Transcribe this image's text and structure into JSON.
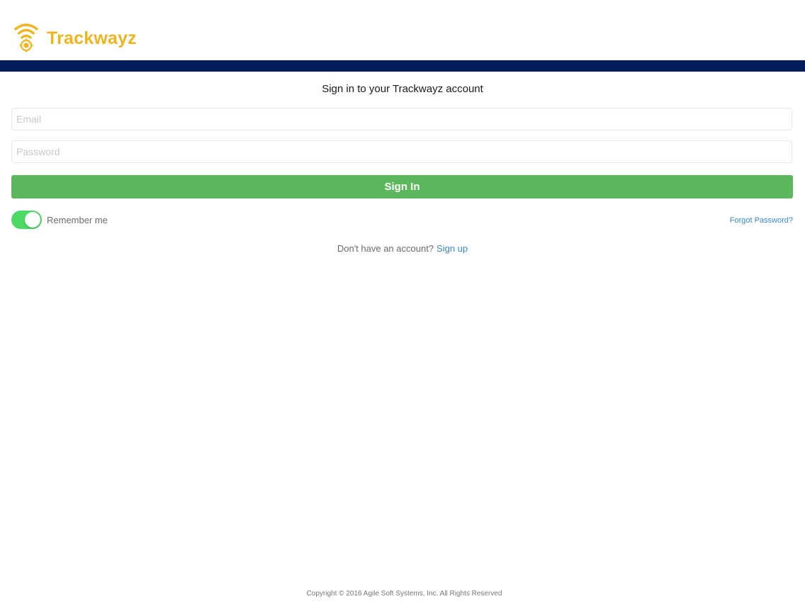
{
  "colors": {
    "brand": "#f0b41c",
    "nav_bar": "#041c5c",
    "primary_button": "#5cb85c",
    "toggle_on": "#4cd964",
    "link": "#3a88c8"
  },
  "header": {
    "logo_icon": "wifi-location-icon",
    "brand_name": "Trackwayz"
  },
  "form": {
    "title": "Sign in to your Trackwayz account",
    "email": {
      "value": "",
      "placeholder": "Email"
    },
    "password": {
      "value": "",
      "placeholder": "Password"
    },
    "submit_label": "Sign In",
    "remember": {
      "label": "Remember me",
      "checked": true
    },
    "forgot_label": "Forgot Password?"
  },
  "signup": {
    "prompt": "Don't have an account?",
    "link_label": "Sign up"
  },
  "footer": {
    "copyright": "Copyright © 2016 Agile Soft Systems, Inc. All Rights Reserved"
  }
}
